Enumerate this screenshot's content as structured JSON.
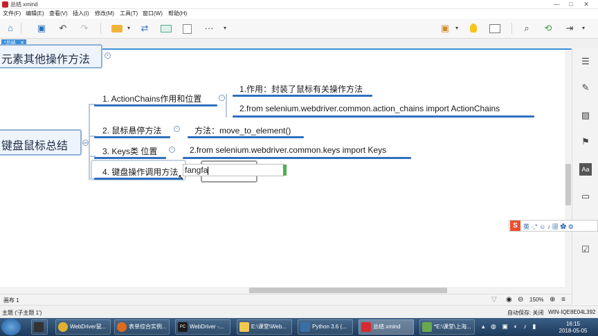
{
  "window": {
    "title": "总结.xmind",
    "minimize": "—",
    "maximize": "□",
    "close": "✕"
  },
  "menu": [
    "文件(F)",
    "编辑(E)",
    "查看(V)",
    "插入(I)",
    "修改(M)",
    "工具(T)",
    "窗口(W)",
    "帮助(H)"
  ],
  "toolbar": {
    "home": "⌂",
    "save": "▣",
    "undo": "↶",
    "redo": "↷",
    "more": "···",
    "dropdown": "▾"
  },
  "tab": {
    "label": "*总结",
    "close": "✕"
  },
  "mindmap": {
    "top_node": "元素其他操作方法",
    "central": "键盘鼠标总结",
    "collapse_minus": "−",
    "topic1": "1. ActionChains作用和位置",
    "topic1_sub1": "1.作用：封装了鼠标有关操作方法",
    "topic1_sub2": "2.from selenium.webdriver.common.action_chains import ActionChains",
    "topic2": "2. 鼠标悬停方法",
    "topic2_sub1": "方法：move_to_element()",
    "topic3": "3. Keys类 位置",
    "topic3_sub1": "2.from selenium.webdriver.common.keys import Keys",
    "topic4": "4. 键盘操作调用方法",
    "editing_text": "fangfa"
  },
  "ime": {
    "logo": "S",
    "lang": "英 ·,° ☺ ♪ ▦ ✿ ⚙"
  },
  "status": {
    "canvas_label": "画布 1",
    "selection": "主题 ('子主题 1')",
    "autosave": "自动保存: 关闭",
    "user": "WIN-IQE8E04L392",
    "zoom": "150%",
    "zoom_minus": "⊖",
    "zoom_plus": "⊕"
  },
  "taskbar": {
    "items": [
      "",
      "",
      "WebDriver鼠...",
      "",
      "表单综合实例...",
      "PC",
      "WebDriver -...",
      "E:\\课堂\\Web...",
      "Python 3.6 (...",
      "总结.xmind",
      "*E:\\课堂\\上海..."
    ],
    "time": "16:15",
    "date": "2018-05-05"
  }
}
